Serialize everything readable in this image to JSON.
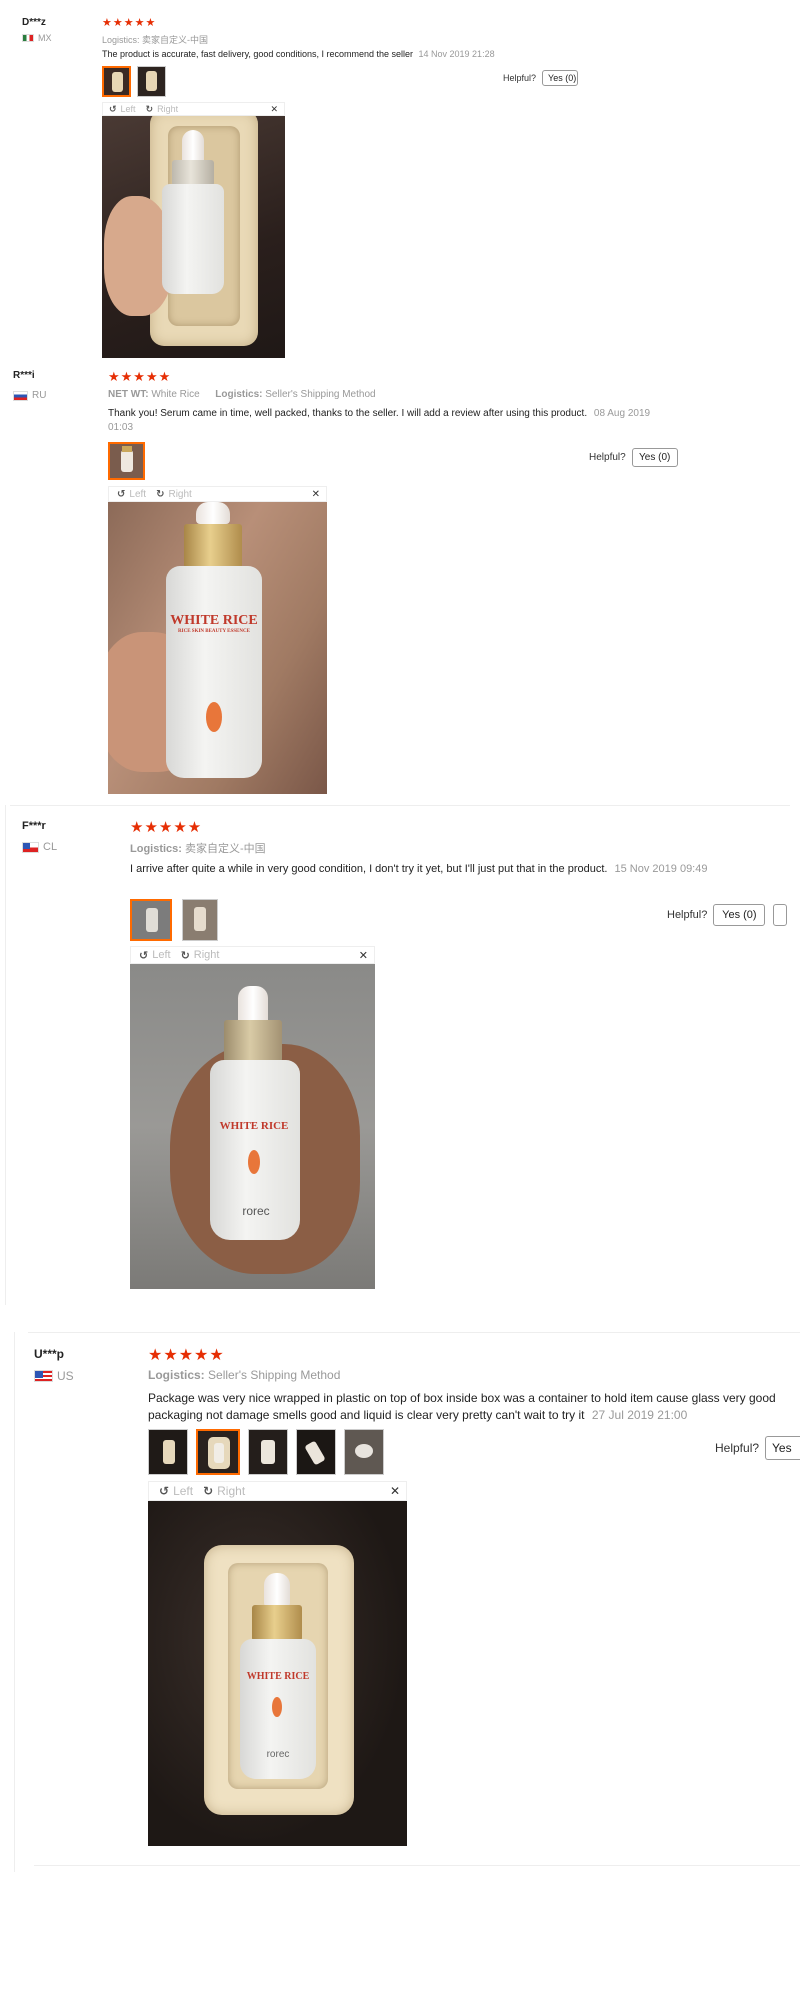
{
  "toolbar_labels": {
    "left": "Left",
    "right": "Right"
  },
  "reviews": [
    {
      "user": "D***z",
      "country": "MX",
      "stars": "★★★★★",
      "logistics_label": "Logistics:",
      "logistics_value": "卖家自定义-中国",
      "comment": "The product is accurate, fast delivery, good conditions, I recommend the seller",
      "date": "14 Nov 2019 21:28",
      "helpful_label": "Helpful?",
      "yes_label": "Yes (0)"
    },
    {
      "user": "R***i",
      "country": "RU",
      "stars": "★★★★★",
      "net_wt_label": "NET WT:",
      "net_wt_value": "White Rice",
      "logistics_label": "Logistics:",
      "logistics_value": "Seller's Shipping Method",
      "comment": "Thank you! Serum came in time, well packed, thanks to the seller. I will add a review after using this product.",
      "date": "08 Aug 2019 01:03",
      "helpful_label": "Helpful?",
      "yes_label": "Yes (0)"
    },
    {
      "user": "F***r",
      "country": "CL",
      "stars": "★★★★★",
      "logistics_label": "Logistics:",
      "logistics_value": "卖家自定义-中国",
      "comment": "I arrive after quite a while in very good condition, I don't try it yet, but I'll just put that in the product.",
      "date": "15 Nov 2019 09:49",
      "helpful_label": "Helpful?",
      "yes_label": "Yes (0)"
    },
    {
      "user": "U***p",
      "country": "US",
      "stars": "★★★★★",
      "logistics_label": "Logistics:",
      "logistics_value": "Seller's Shipping Method",
      "comment": "Package was very nice wrapped in plastic on top of box inside box was a container to hold item cause glass very good packaging not damage smells good and liquid is clear very pretty can't wait to try it",
      "date": "27 Jul 2019 21:00",
      "helpful_label": "Helpful?",
      "yes_label": "Yes"
    }
  ],
  "bottle_label": {
    "line1": "WHITE RICE",
    "line2": "RICE SKIN BEAUTY ESSENCE",
    "brand": "rorec"
  },
  "colors": {
    "stars": "#e62e04",
    "active_thumb": "#ff6a00",
    "muted": "#999999"
  }
}
